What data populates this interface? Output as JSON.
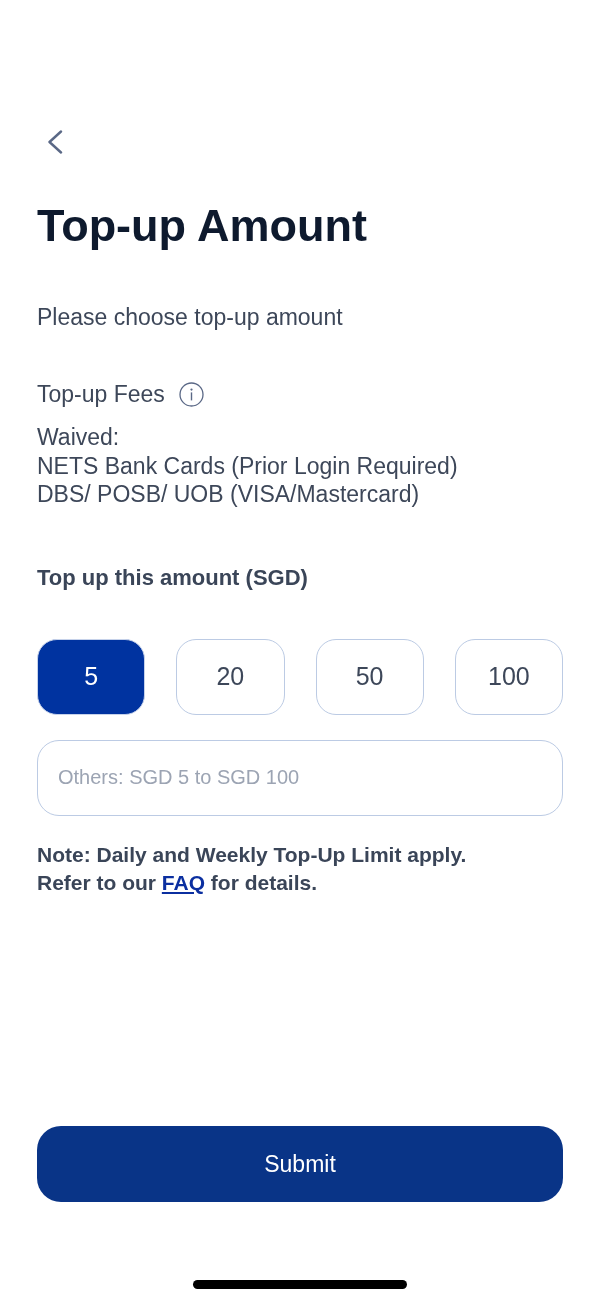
{
  "header": {
    "title": "Top-up Amount"
  },
  "instruction": "Please choose top-up amount",
  "fees": {
    "label": "Top-up Fees",
    "lines": [
      "Waived:",
      "NETS Bank Cards (Prior Login Required)",
      "DBS/ POSB/ UOB (VISA/Mastercard)"
    ]
  },
  "amount": {
    "label": "Top up this amount (SGD)",
    "options": [
      {
        "label": "5",
        "selected": true
      },
      {
        "label": "20",
        "selected": false
      },
      {
        "label": "50",
        "selected": false
      },
      {
        "label": "100",
        "selected": false
      }
    ],
    "other_field": {
      "placeholder": "Others: SGD 5 to SGD 100"
    }
  },
  "note": {
    "first_line": "Note: Daily and Weekly Top-Up Limit apply.",
    "before_link": "Refer to our",
    "link": "FAQ",
    "after_link": "for details."
  },
  "submit": {
    "label": "Submit"
  }
}
